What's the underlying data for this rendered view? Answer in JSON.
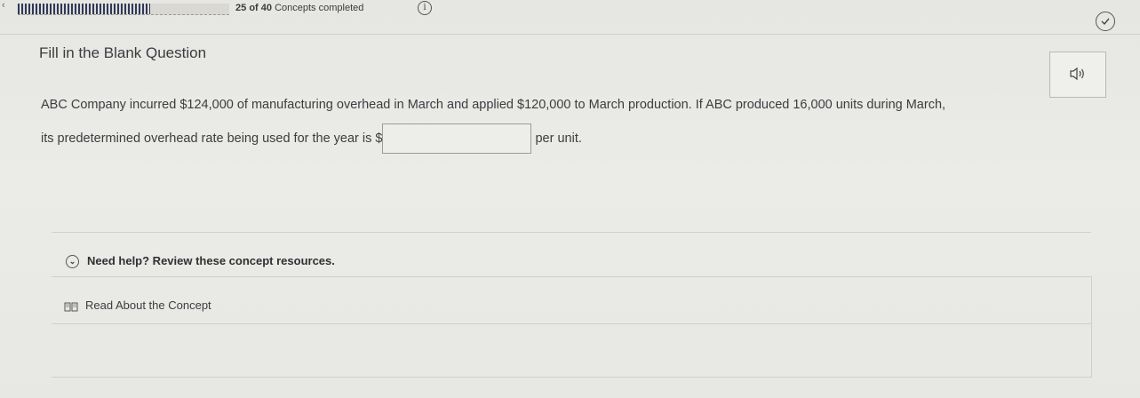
{
  "header": {
    "progress_fraction": 0.625,
    "progress_current": "25",
    "progress_of": "of",
    "progress_total": "40",
    "progress_label": "Concepts completed",
    "info_icon": "info-icon",
    "info_glyph": "i",
    "check_icon": "check-circle-icon"
  },
  "question": {
    "type_label": "Fill in the Blank Question",
    "text_line1": "ABC Company incurred $124,000 of manufacturing overhead in March and applied $120,000 to March production. If ABC produced 16,000 units during March,",
    "text_line2_before": "its predetermined overhead rate being used for the year is $",
    "answer_value": "",
    "text_line2_after": "per unit."
  },
  "help": {
    "toggle_label": "Need help? Review these concept resources.",
    "resource_link": "Read About the Concept"
  }
}
